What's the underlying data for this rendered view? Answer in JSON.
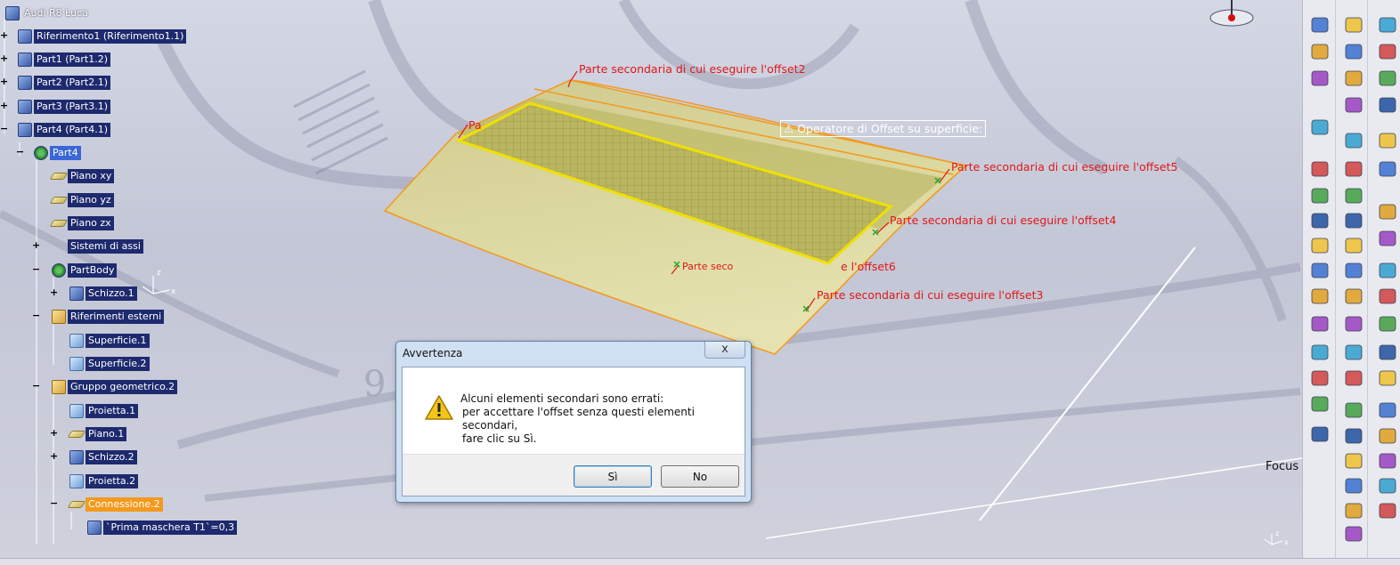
{
  "spec_tree": {
    "items": [
      {
        "label": "Audi R8 Luca",
        "icon": "product-icon",
        "expander": ""
      },
      {
        "label": "Riferimento1 (Riferimento1.1)",
        "icon": "product-icon",
        "expander": "+"
      },
      {
        "label": "Part1 (Part1.2)",
        "icon": "product-icon",
        "expander": "+"
      },
      {
        "label": "Part2 (Part2.1)",
        "icon": "product-icon",
        "expander": "+"
      },
      {
        "label": "Part3 (Part3.1)",
        "icon": "product-icon",
        "expander": "+"
      },
      {
        "label": "Part4 (Part4.1)",
        "icon": "product-icon",
        "expander": "−"
      },
      {
        "label": "Part4",
        "icon": "part-gear-icon",
        "expander": "−"
      },
      {
        "label": "Piano xy",
        "icon": "plane-icon",
        "expander": ""
      },
      {
        "label": "Piano yz",
        "icon": "plane-icon",
        "expander": ""
      },
      {
        "label": "Piano zx",
        "icon": "plane-icon",
        "expander": ""
      },
      {
        "label": "Sistemi di assi",
        "icon": "axis-system-icon",
        "expander": "+"
      },
      {
        "label": "PartBody",
        "icon": "part-gear-icon",
        "expander": "−"
      },
      {
        "label": "Schizzo.1",
        "icon": "sketch-icon",
        "expander": "+"
      },
      {
        "label": "Riferimenti esterni",
        "icon": "geometric-set-icon",
        "expander": "−"
      },
      {
        "label": "Superficie.1",
        "icon": "surface-icon",
        "expander": ""
      },
      {
        "label": "Superficie.2",
        "icon": "surface-icon",
        "expander": ""
      },
      {
        "label": "Gruppo geometrico.2",
        "icon": "geometric-set-icon",
        "expander": "−"
      },
      {
        "label": "Proietta.1",
        "icon": "projection-icon",
        "expander": ""
      },
      {
        "label": "Piano.1",
        "icon": "plane-icon",
        "expander": "+"
      },
      {
        "label": "Schizzo.2",
        "icon": "sketch-icon",
        "expander": "+"
      },
      {
        "label": "Proietta.2",
        "icon": "projection-icon",
        "expander": ""
      },
      {
        "label": "Connessione.2",
        "icon": "join-icon",
        "expander": "−"
      },
      {
        "label": "`Prima maschera T1`=0,3",
        "icon": "parameter-icon",
        "expander": ""
      }
    ]
  },
  "viewport": {
    "annotations": [
      "Parte secondaria di cui eseguire l'offset2",
      "Parte secondaria di cui eseguire l'offset5",
      "Parte secondaria di cui eseguire l'offset4",
      "e l'offset6",
      "Parte secondaria di cui eseguire l'offset3",
      "Parte seco",
      "Pa"
    ],
    "hint": "Operatore di Offset su superficie:",
    "focus_label": "Focus",
    "surface_color": "#c9c48a",
    "highlight_color": "#f0e000",
    "annotation_color": "#e01818"
  },
  "dialog": {
    "title": "Avvertenza",
    "close": "x",
    "line1": "Alcuni elementi secondari sono errati:",
    "line2": "per accettare l'offset senza questi elementi secondari,",
    "line3": "fare clic su Sì.",
    "yes": "Sì",
    "no": "No"
  }
}
